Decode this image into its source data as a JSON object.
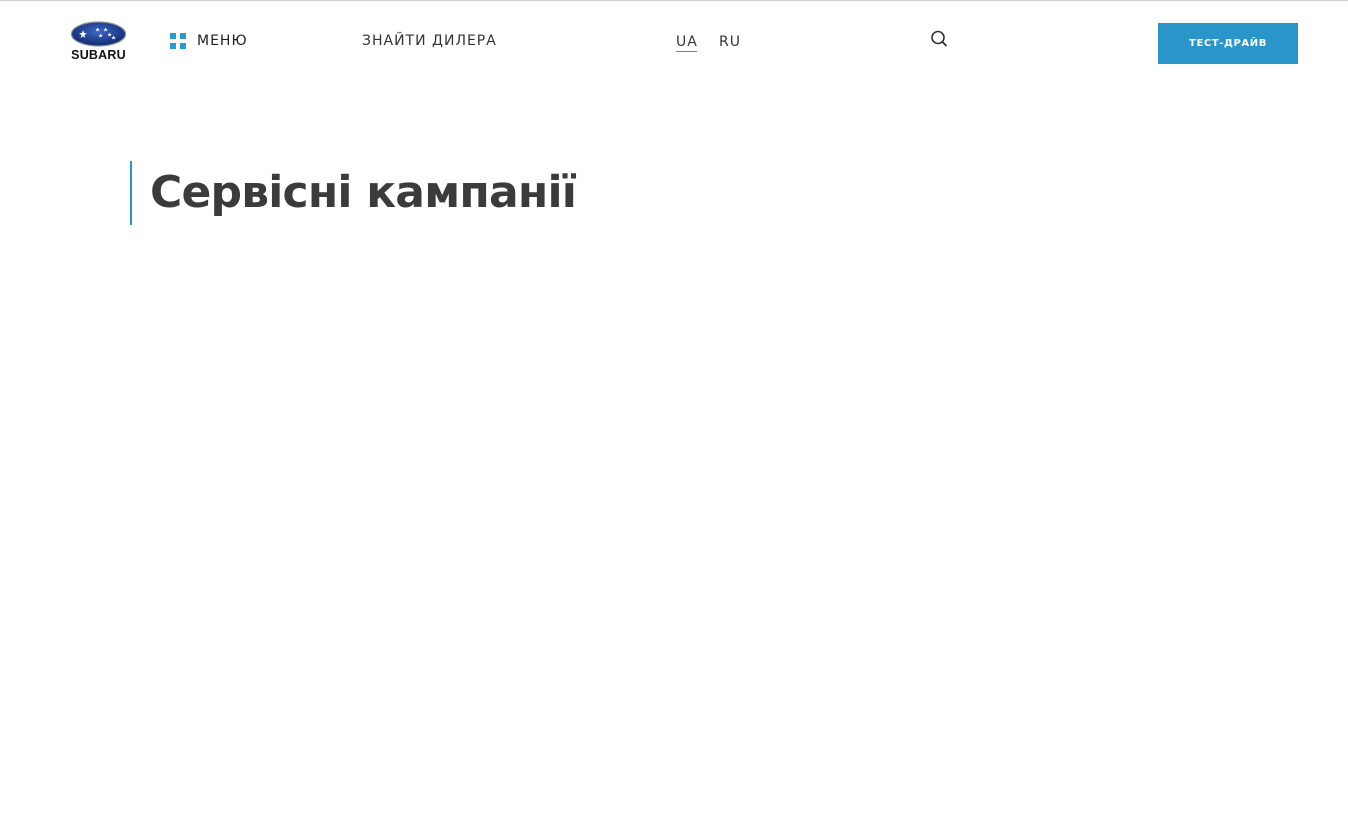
{
  "header": {
    "logo_text": "SUBARU",
    "menu_label": "МЕНЮ",
    "dealer_link": "ЗНАЙТИ ДИЛЕРА",
    "languages": [
      {
        "code": "UA",
        "active": true
      },
      {
        "code": "RU",
        "active": false
      }
    ],
    "search_icon": "search-icon",
    "cta_label": "ТЕСТ-ДРАЙВ"
  },
  "main": {
    "title": "Сервісні кампанії"
  },
  "colors": {
    "accent": "#2a95c8",
    "logo_oval": "#1b3a8c",
    "title_text": "#3b3b3b"
  }
}
